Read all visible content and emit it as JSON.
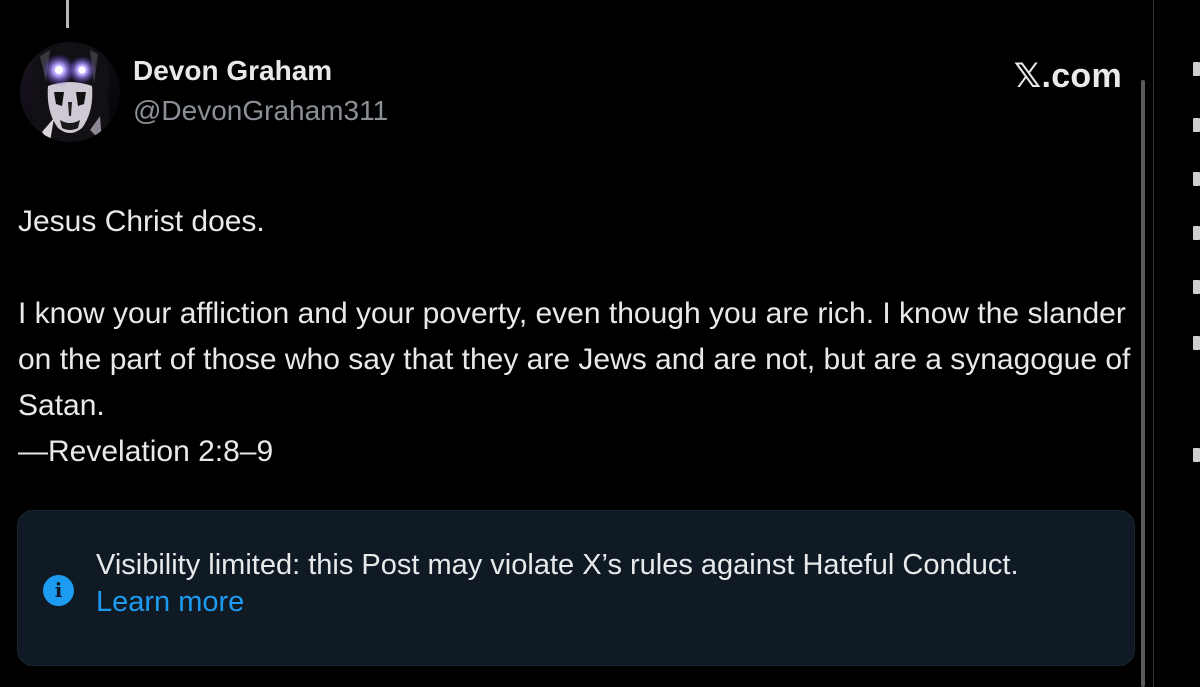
{
  "post": {
    "author": {
      "display_name": "Devon Graham",
      "handle": "@DevonGraham311"
    },
    "site": "𝕏.com",
    "paragraphs": [
      "Jesus Christ does.",
      "I know your affliction and your poverty, even though you are rich. I know the slander on the part of those who say that they are Jews and are not, but are a synagogue of Satan.\n—Revelation 2:8–9"
    ]
  },
  "notice": {
    "icon": "info-icon",
    "message": "Visibility limited: this Post may violate X’s rules against Hateful Conduct.",
    "link_label": "Learn more"
  },
  "colors": {
    "background": "#000000",
    "text": "#e7e9ea",
    "secondary_text": "#8b9097",
    "accent": "#1d9bf0",
    "notice_background": "#0f1a24"
  }
}
